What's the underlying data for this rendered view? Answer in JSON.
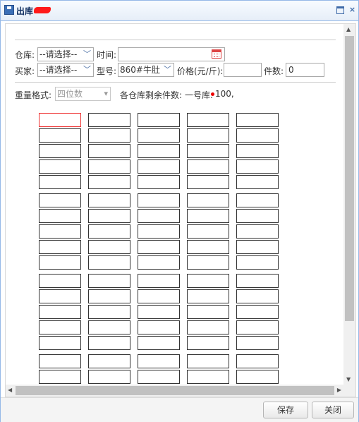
{
  "window": {
    "title": "出库"
  },
  "form": {
    "warehouse_label": "仓库:",
    "warehouse_value": "--请选择--",
    "time_label": "时间:",
    "time_value": "",
    "buyer_label": "买家:",
    "buyer_value": "--请选择--",
    "model_label": "型号:",
    "model_value": "860#牛肚",
    "price_label": "价格(元/斤):",
    "price_value": "",
    "count_label": "件数:",
    "count_value": "0",
    "weight_format_label": "重量格式:",
    "weight_format_value": "四位数",
    "remaining_label": "各仓库剩余件数:",
    "remaining_warehouse": "一号库:",
    "remaining_value": "100,"
  },
  "grid": {
    "columns": 5,
    "rows": 17,
    "active_cell": 0
  },
  "footer": {
    "save_label": "保存",
    "close_label": "关闭"
  },
  "colors": {
    "window_border": "#95b8e7",
    "active_cell_border": "#ee3333",
    "cell_border": "#333333"
  }
}
